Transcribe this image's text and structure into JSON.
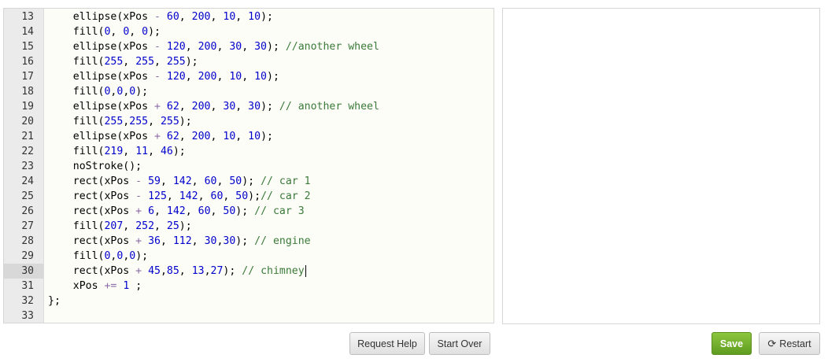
{
  "editor": {
    "active_line": "30",
    "lines": [
      {
        "n": "13",
        "tokens": [
          [
            "p",
            "    ellipse(xPos "
          ],
          [
            "o",
            "-"
          ],
          [
            "p",
            " "
          ],
          [
            "n",
            "60"
          ],
          [
            "p",
            ", "
          ],
          [
            "n",
            "200"
          ],
          [
            "p",
            ", "
          ],
          [
            "n",
            "10"
          ],
          [
            "p",
            ", "
          ],
          [
            "n",
            "10"
          ],
          [
            "p",
            ");"
          ]
        ]
      },
      {
        "n": "14",
        "tokens": [
          [
            "p",
            "    fill("
          ],
          [
            "n",
            "0"
          ],
          [
            "p",
            ", "
          ],
          [
            "n",
            "0"
          ],
          [
            "p",
            ", "
          ],
          [
            "n",
            "0"
          ],
          [
            "p",
            ");"
          ]
        ]
      },
      {
        "n": "15",
        "tokens": [
          [
            "p",
            "    ellipse(xPos "
          ],
          [
            "o",
            "-"
          ],
          [
            "p",
            " "
          ],
          [
            "n",
            "120"
          ],
          [
            "p",
            ", "
          ],
          [
            "n",
            "200"
          ],
          [
            "p",
            ", "
          ],
          [
            "n",
            "30"
          ],
          [
            "p",
            ", "
          ],
          [
            "n",
            "30"
          ],
          [
            "p",
            "); "
          ],
          [
            "c",
            "//another wheel"
          ]
        ]
      },
      {
        "n": "16",
        "tokens": [
          [
            "p",
            "    fill("
          ],
          [
            "n",
            "255"
          ],
          [
            "p",
            ", "
          ],
          [
            "n",
            "255"
          ],
          [
            "p",
            ", "
          ],
          [
            "n",
            "255"
          ],
          [
            "p",
            ");"
          ]
        ]
      },
      {
        "n": "17",
        "tokens": [
          [
            "p",
            "    ellipse(xPos "
          ],
          [
            "o",
            "-"
          ],
          [
            "p",
            " "
          ],
          [
            "n",
            "120"
          ],
          [
            "p",
            ", "
          ],
          [
            "n",
            "200"
          ],
          [
            "p",
            ", "
          ],
          [
            "n",
            "10"
          ],
          [
            "p",
            ", "
          ],
          [
            "n",
            "10"
          ],
          [
            "p",
            ");"
          ]
        ]
      },
      {
        "n": "18",
        "tokens": [
          [
            "p",
            "    fill("
          ],
          [
            "n",
            "0"
          ],
          [
            "p",
            ","
          ],
          [
            "n",
            "0"
          ],
          [
            "p",
            ","
          ],
          [
            "n",
            "0"
          ],
          [
            "p",
            ");"
          ]
        ]
      },
      {
        "n": "19",
        "tokens": [
          [
            "p",
            "    ellipse(xPos "
          ],
          [
            "o",
            "+"
          ],
          [
            "p",
            " "
          ],
          [
            "n",
            "62"
          ],
          [
            "p",
            ", "
          ],
          [
            "n",
            "200"
          ],
          [
            "p",
            ", "
          ],
          [
            "n",
            "30"
          ],
          [
            "p",
            ", "
          ],
          [
            "n",
            "30"
          ],
          [
            "p",
            "); "
          ],
          [
            "c",
            "// another wheel"
          ]
        ]
      },
      {
        "n": "20",
        "tokens": [
          [
            "p",
            "    fill("
          ],
          [
            "n",
            "255"
          ],
          [
            "p",
            ","
          ],
          [
            "n",
            "255"
          ],
          [
            "p",
            ", "
          ],
          [
            "n",
            "255"
          ],
          [
            "p",
            ");"
          ]
        ]
      },
      {
        "n": "21",
        "tokens": [
          [
            "p",
            "    ellipse(xPos "
          ],
          [
            "o",
            "+"
          ],
          [
            "p",
            " "
          ],
          [
            "n",
            "62"
          ],
          [
            "p",
            ", "
          ],
          [
            "n",
            "200"
          ],
          [
            "p",
            ", "
          ],
          [
            "n",
            "10"
          ],
          [
            "p",
            ", "
          ],
          [
            "n",
            "10"
          ],
          [
            "p",
            ");"
          ]
        ]
      },
      {
        "n": "22",
        "tokens": [
          [
            "p",
            "    fill("
          ],
          [
            "n",
            "219"
          ],
          [
            "p",
            ", "
          ],
          [
            "n",
            "11"
          ],
          [
            "p",
            ", "
          ],
          [
            "n",
            "46"
          ],
          [
            "p",
            ");"
          ]
        ]
      },
      {
        "n": "23",
        "tokens": [
          [
            "p",
            "    noStroke();"
          ]
        ]
      },
      {
        "n": "24",
        "tokens": [
          [
            "p",
            "    rect(xPos "
          ],
          [
            "o",
            "-"
          ],
          [
            "p",
            " "
          ],
          [
            "n",
            "59"
          ],
          [
            "p",
            ", "
          ],
          [
            "n",
            "142"
          ],
          [
            "p",
            ", "
          ],
          [
            "n",
            "60"
          ],
          [
            "p",
            ", "
          ],
          [
            "n",
            "50"
          ],
          [
            "p",
            "); "
          ],
          [
            "c",
            "// car 1"
          ]
        ]
      },
      {
        "n": "25",
        "tokens": [
          [
            "p",
            "    rect(xPos "
          ],
          [
            "o",
            "-"
          ],
          [
            "p",
            " "
          ],
          [
            "n",
            "125"
          ],
          [
            "p",
            ", "
          ],
          [
            "n",
            "142"
          ],
          [
            "p",
            ", "
          ],
          [
            "n",
            "60"
          ],
          [
            "p",
            ", "
          ],
          [
            "n",
            "50"
          ],
          [
            "p",
            ");"
          ],
          [
            "c",
            "// car 2"
          ]
        ]
      },
      {
        "n": "26",
        "tokens": [
          [
            "p",
            "    rect(xPos "
          ],
          [
            "o",
            "+"
          ],
          [
            "p",
            " "
          ],
          [
            "n",
            "6"
          ],
          [
            "p",
            ", "
          ],
          [
            "n",
            "142"
          ],
          [
            "p",
            ", "
          ],
          [
            "n",
            "60"
          ],
          [
            "p",
            ", "
          ],
          [
            "n",
            "50"
          ],
          [
            "p",
            "); "
          ],
          [
            "c",
            "// car 3"
          ]
        ]
      },
      {
        "n": "27",
        "tokens": [
          [
            "p",
            "    fill("
          ],
          [
            "n",
            "207"
          ],
          [
            "p",
            ", "
          ],
          [
            "n",
            "252"
          ],
          [
            "p",
            ", "
          ],
          [
            "n",
            "25"
          ],
          [
            "p",
            ");"
          ]
        ]
      },
      {
        "n": "28",
        "tokens": [
          [
            "p",
            "    rect(xPos "
          ],
          [
            "o",
            "+"
          ],
          [
            "p",
            " "
          ],
          [
            "n",
            "36"
          ],
          [
            "p",
            ", "
          ],
          [
            "n",
            "112"
          ],
          [
            "p",
            ", "
          ],
          [
            "n",
            "30"
          ],
          [
            "p",
            ","
          ],
          [
            "n",
            "30"
          ],
          [
            "p",
            "); "
          ],
          [
            "c",
            "// engine"
          ]
        ]
      },
      {
        "n": "29",
        "tokens": [
          [
            "p",
            "    fill("
          ],
          [
            "n",
            "0"
          ],
          [
            "p",
            ","
          ],
          [
            "n",
            "0"
          ],
          [
            "p",
            ","
          ],
          [
            "n",
            "0"
          ],
          [
            "p",
            ");"
          ]
        ]
      },
      {
        "n": "30",
        "tokens": [
          [
            "p",
            "    rect(xPos "
          ],
          [
            "o",
            "+"
          ],
          [
            "p",
            " "
          ],
          [
            "n",
            "45"
          ],
          [
            "p",
            ","
          ],
          [
            "n",
            "85"
          ],
          [
            "p",
            ", "
          ],
          [
            "n",
            "13"
          ],
          [
            "p",
            ","
          ],
          [
            "n",
            "27"
          ],
          [
            "p",
            "); "
          ],
          [
            "c",
            "// chimney"
          ]
        ]
      },
      {
        "n": "31",
        "tokens": [
          [
            "p",
            "    xPos "
          ],
          [
            "o",
            "+="
          ],
          [
            "p",
            " "
          ],
          [
            "n",
            "1"
          ],
          [
            "p",
            " ;"
          ]
        ]
      },
      {
        "n": "32",
        "tokens": [
          [
            "p",
            "};"
          ]
        ]
      },
      {
        "n": "33",
        "tokens": []
      }
    ]
  },
  "buttons": {
    "request_help": "Request Help",
    "start_over": "Start Over",
    "save": "Save",
    "restart": "Restart"
  },
  "icons": {
    "restart": "refresh-icon"
  },
  "colors": {
    "save_button": "#6fae2a",
    "number": "#0000cd",
    "comment": "#3a7a3a",
    "operator": "#8b6ba8"
  }
}
